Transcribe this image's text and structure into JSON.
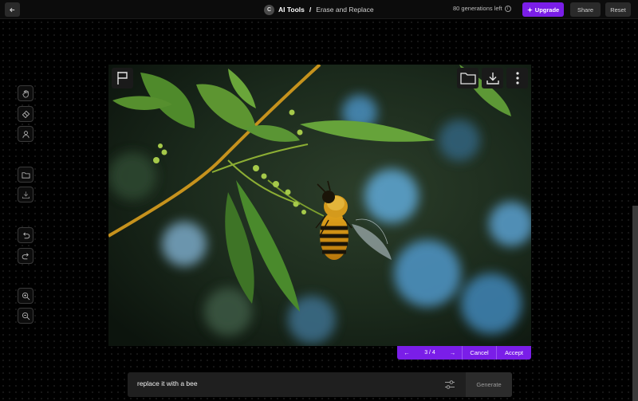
{
  "header": {
    "logo_letter": "C",
    "app_name": "AI Tools",
    "separator": "/",
    "page_name": "Erase and Replace",
    "generations_left": "80 generations left",
    "info_glyph": "i",
    "upgrade_label": "Upgrade",
    "share_label": "Share",
    "reset_label": "Reset"
  },
  "toolbar": {
    "tools": [
      "hand-icon",
      "eraser-icon",
      "person-icon",
      "folder-icon",
      "download-icon",
      "undo-icon",
      "redo-icon",
      "zoom-in-icon",
      "zoom-out-icon"
    ]
  },
  "canvas": {
    "image_subject": "bee-on-branch",
    "overlay_buttons": [
      "flag-icon",
      "folder-icon",
      "download-icon",
      "more-icon"
    ]
  },
  "variants": {
    "prev_glyph": "←",
    "counter": "3 / 4",
    "next_glyph": "→",
    "cancel_label": "Cancel",
    "accept_label": "Accept"
  },
  "prompt": {
    "value": "replace it with a bee",
    "generate_label": "Generate"
  },
  "colors": {
    "accent": "#7a1ee8",
    "background": "#000000"
  }
}
